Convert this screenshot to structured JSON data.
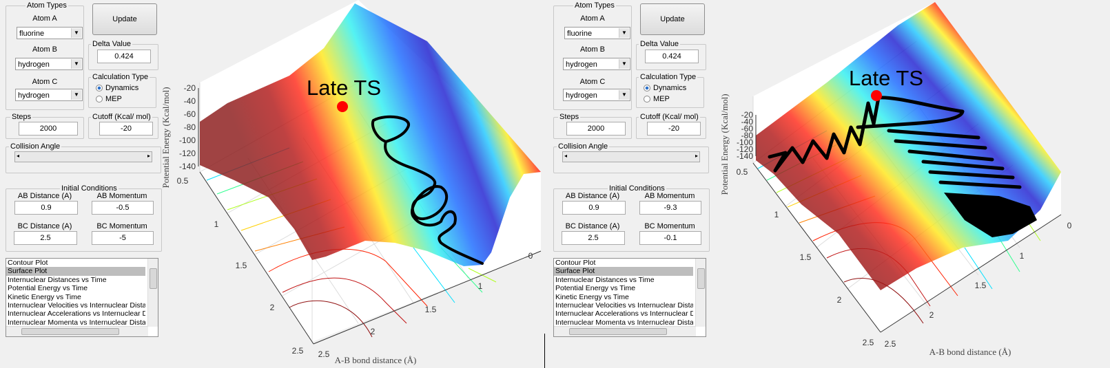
{
  "panels": [
    {
      "atom_types_title": "Atom Types",
      "atom_a_label": "Atom A",
      "atom_a_value": "fluorine",
      "atom_b_label": "Atom B",
      "atom_b_value": "hydrogen",
      "atom_c_label": "Atom C",
      "atom_c_value": "hydrogen",
      "update_label": "Update",
      "delta_title": "Delta Value",
      "delta_value": "0.424",
      "calc_title": "Calculation Type",
      "calc_options": [
        "Dynamics",
        "MEP"
      ],
      "calc_selected": "Dynamics",
      "steps_title": "Steps",
      "steps_value": "2000",
      "cutoff_title": "Cutoff (Kcal/ mol)",
      "cutoff_value": "-20",
      "collision_title": "Collision Angle",
      "ic_title": "Initial Conditions",
      "ab_dist_label": "AB Distance (A)",
      "ab_dist_value": "0.9",
      "ab_mom_label": "AB Momentum",
      "ab_mom_value": "-0.5",
      "bc_dist_label": "BC Distance (A)",
      "bc_dist_value": "2.5",
      "bc_mom_label": "BC Momentum",
      "bc_mom_value": "-5",
      "plot_list": [
        "Contour Plot",
        "Surface Plot",
        "Internuclear Distances vs Time",
        "Potential Energy vs Time",
        "Kinetic Energy vs Time",
        "Internuclear Velocities vs Internuclear Distance",
        "Internuclear Accelerations vs Internuclear Distance",
        "Internuclear Momenta vs Internuclear Distance"
      ],
      "plot_list_selected": "Surface Plot",
      "plot": {
        "annotation": "Late TS",
        "zlabel": "Potential Energy (Kcal/mol)",
        "xlabel": "A-B bond distance (Å)",
        "z_ticks": [
          "-20",
          "-40",
          "-60",
          "-80",
          "-100",
          "-120",
          "-140"
        ],
        "left_ticks": [
          "0.5",
          "1",
          "1.5",
          "2",
          "2.5"
        ],
        "bottom_ticks": [
          "2.5",
          "2",
          "1.5",
          "1",
          "0"
        ]
      }
    },
    {
      "atom_types_title": "Atom Types",
      "atom_a_label": "Atom A",
      "atom_a_value": "fluorine",
      "atom_b_label": "Atom B",
      "atom_b_value": "hydrogen",
      "atom_c_label": "Atom C",
      "atom_c_value": "hydrogen",
      "update_label": "Update",
      "delta_title": "Delta Value",
      "delta_value": "0.424",
      "calc_title": "Calculation Type",
      "calc_options": [
        "Dynamics",
        "MEP"
      ],
      "calc_selected": "Dynamics",
      "steps_title": "Steps",
      "steps_value": "2000",
      "cutoff_title": "Cutoff (Kcal/ mol)",
      "cutoff_value": "-20",
      "collision_title": "Collision Angle",
      "ic_title": "Initial Conditions",
      "ab_dist_label": "AB Distance (A)",
      "ab_dist_value": "0.9",
      "ab_mom_label": "AB Momentum",
      "ab_mom_value": "-9.3",
      "bc_dist_label": "BC Distance (A)",
      "bc_dist_value": "2.5",
      "bc_mom_label": "BC Momentum",
      "bc_mom_value": "-0.1",
      "plot_list": [
        "Contour Plot",
        "Surface Plot",
        "Internuclear Distances vs Time",
        "Potential Energy vs Time",
        "Kinetic Energy vs Time",
        "Internuclear Velocities vs Internuclear Distance",
        "Internuclear Accelerations vs Internuclear Distance",
        "Internuclear Momenta vs Internuclear Distance"
      ],
      "plot_list_selected": "Surface Plot",
      "plot": {
        "annotation": "Late TS",
        "zlabel": "Potential Energy (Kcal/mol)",
        "xlabel": "A-B bond distance (Å)",
        "z_ticks": [
          "-20",
          "-40",
          "-60",
          "-80",
          "-100",
          "-120",
          "-140"
        ],
        "left_ticks": [
          "0.5",
          "1",
          "1.5",
          "2",
          "2.5"
        ],
        "bottom_ticks": [
          "2.5",
          "2",
          "1.5",
          "1",
          "0"
        ]
      }
    }
  ],
  "colors": {
    "ts_marker": "#ff0000",
    "trajectory": "#000000",
    "colormap": "jet"
  }
}
